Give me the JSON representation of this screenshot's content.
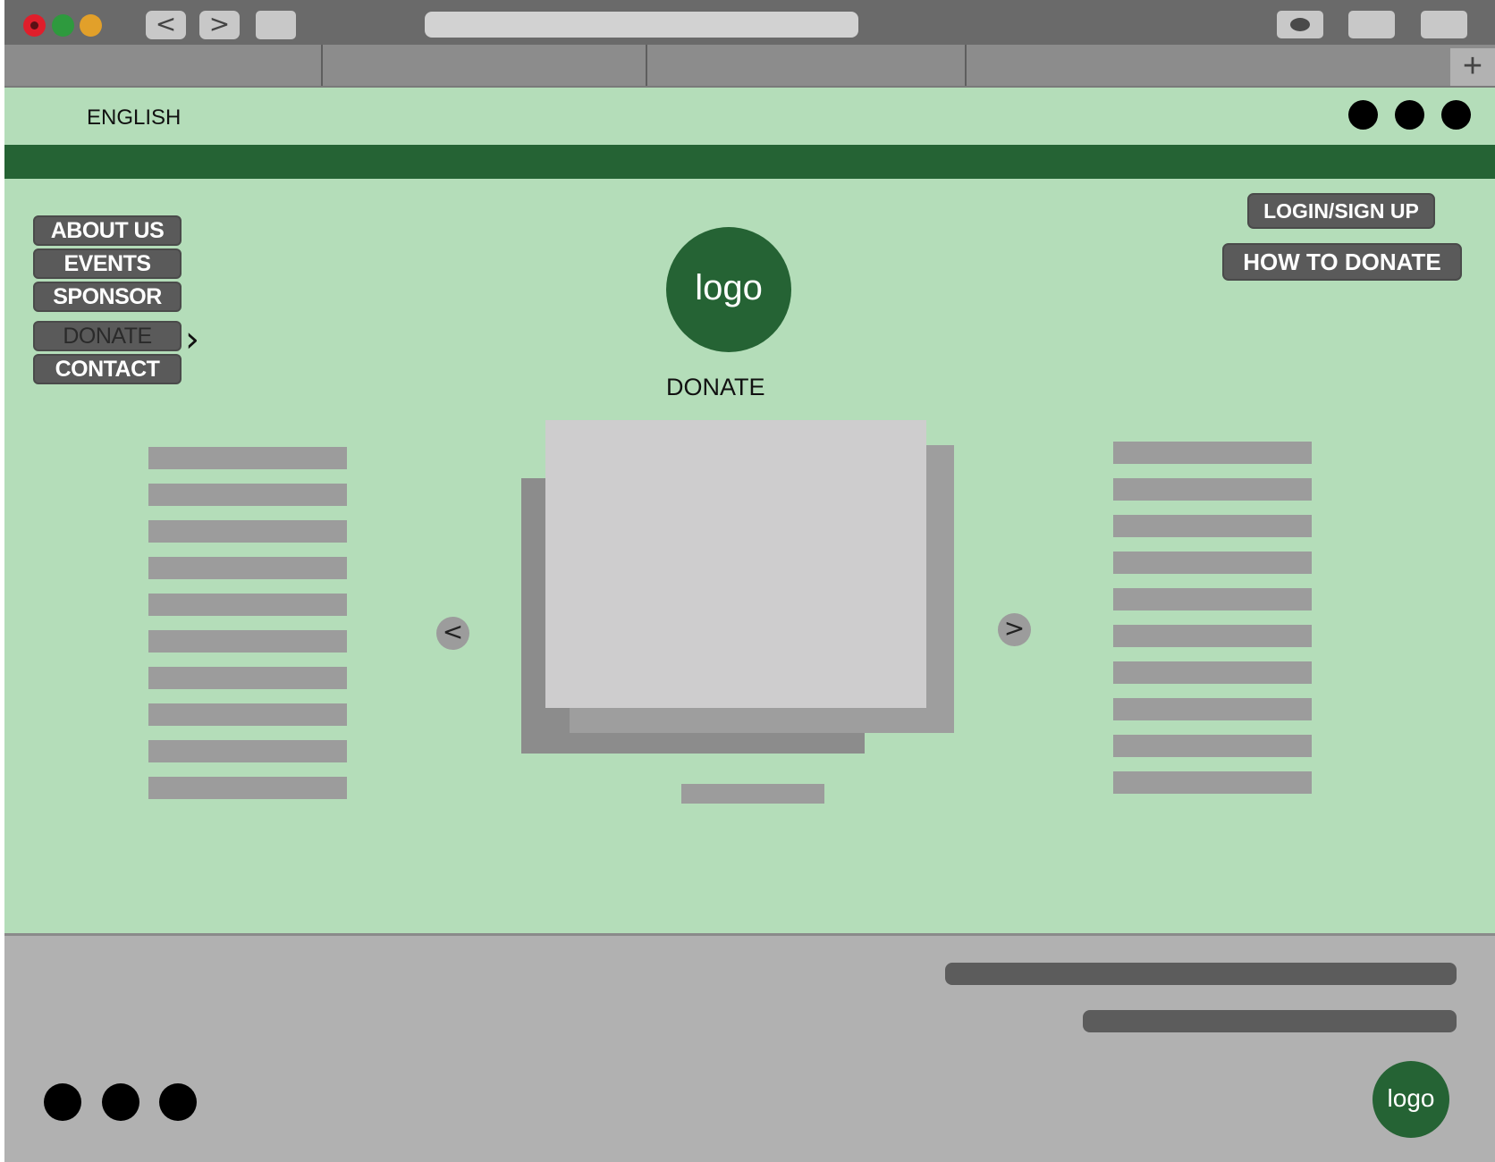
{
  "browser": {
    "back_glyph": "<",
    "forward_glyph": ">",
    "new_tab_glyph": "+",
    "icons": [
      "close-window-icon",
      "minimize-window-icon",
      "maximize-window-icon",
      "eye-icon"
    ]
  },
  "header": {
    "language": "ENGLISH",
    "social_icons": [
      "social-icon-1",
      "social-icon-2",
      "social-icon-3"
    ]
  },
  "nav": {
    "items": [
      {
        "label": "ABOUT US"
      },
      {
        "label": "EVENTS"
      },
      {
        "label": "SPONSOR"
      },
      {
        "label": "DONATE",
        "active": true
      },
      {
        "label": "CONTACT"
      }
    ],
    "active_indicator": "chevron-right-icon"
  },
  "hero": {
    "logo_text": "logo",
    "page_caption": "DONATE"
  },
  "actions": {
    "login_label": "LOGIN/SIGN UP",
    "how_to_donate_label": "HOW TO DONATE"
  },
  "carousel": {
    "prev_glyph": "<",
    "next_glyph": ">"
  },
  "footer": {
    "logo_text": "logo",
    "social_icons": [
      "social-icon-1",
      "social-icon-2",
      "social-icon-3"
    ]
  },
  "colors": {
    "page_background": "#b4ddb9",
    "brand_green": "#256334",
    "button_gray": "#5a5a5a",
    "footer_gray": "#b1b1b1",
    "placeholder_gray": "#9c9c9c"
  }
}
